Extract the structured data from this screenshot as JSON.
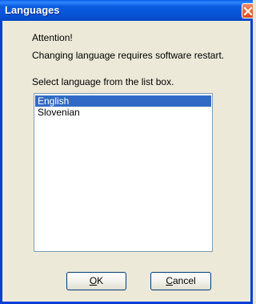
{
  "window": {
    "title": "Languages"
  },
  "message": {
    "line1": "Attention!",
    "line2": "Changing language requires software restart."
  },
  "prompt": "Select language from the list box.",
  "languages": {
    "items": [
      "English",
      "Slovenian"
    ],
    "selected": "English"
  },
  "buttons": {
    "ok_mnemonic": "O",
    "ok_rest": "K",
    "cancel_mnemonic": "C",
    "cancel_rest": "ancel"
  },
  "icons": {
    "close": "close-icon"
  },
  "colors": {
    "selection": "#316ac5",
    "titlebar": "#0653d6",
    "close_button": "#d8481f",
    "dialog_background": "#ece9d8"
  }
}
